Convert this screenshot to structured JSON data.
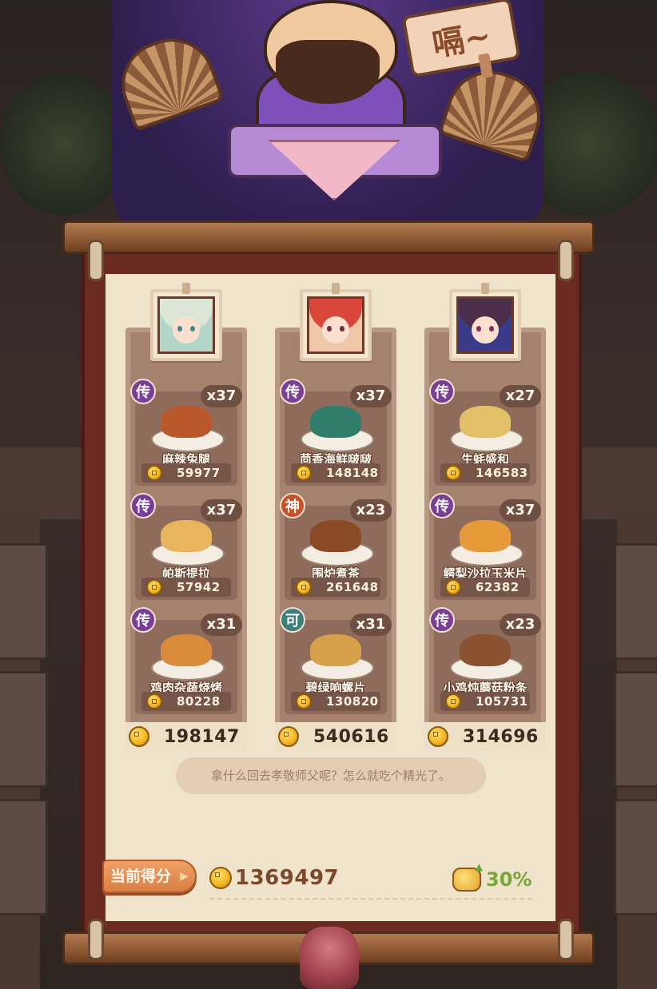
{
  "header": {
    "speech_sign": "嗝~"
  },
  "columns": [
    {
      "portrait": "character-1",
      "dishes": [
        {
          "rarity": "传",
          "rarity_color": "#7a3f94",
          "count": "x37",
          "name": "麻辣兔腿",
          "value": "59977",
          "food_color": "#b9582b"
        },
        {
          "rarity": "传",
          "rarity_color": "#7a3f94",
          "count": "x37",
          "name": "帕斯提拉",
          "value": "57942",
          "food_color": "#e6b55d"
        },
        {
          "rarity": "传",
          "rarity_color": "#7a3f94",
          "count": "x31",
          "name": "鸡肉杂蔬烧烤",
          "value": "80228",
          "food_color": "#d98a3a"
        }
      ],
      "total": "198147"
    },
    {
      "portrait": "character-2",
      "dishes": [
        {
          "rarity": "传",
          "rarity_color": "#7a3f94",
          "count": "x37",
          "name": "茴香海鲜啵啵",
          "value": "148148",
          "food_color": "#2f7d6a"
        },
        {
          "rarity": "神",
          "rarity_color": "#c8522b",
          "count": "x23",
          "name": "围炉煮茶",
          "value": "261648",
          "food_color": "#8a4a26"
        },
        {
          "rarity": "可",
          "rarity_color": "#3c7f7a",
          "count": "x31",
          "name": "碧绿响螺片",
          "value": "130820",
          "food_color": "#d7a04a"
        }
      ],
      "total": "540616"
    },
    {
      "portrait": "character-3",
      "dishes": [
        {
          "rarity": "传",
          "rarity_color": "#7a3f94",
          "count": "x27",
          "name": "生蚝盛和",
          "value": "146583",
          "food_color": "#e1c067"
        },
        {
          "rarity": "传",
          "rarity_color": "#7a3f94",
          "count": "x37",
          "name": "鳄梨沙拉玉米片",
          "value": "62382",
          "food_color": "#e79a3a"
        },
        {
          "rarity": "传",
          "rarity_color": "#7a3f94",
          "count": "x23",
          "name": "小鸡炖蘑菇粉条",
          "value": "105731",
          "food_color": "#8a5230"
        }
      ],
      "total": "314696"
    }
  ],
  "message": "拿什么回去孝敬师父呢？怎么就吃个精光了。",
  "footer": {
    "score_label": "当前得分",
    "total_score": "1369497",
    "bonus_percent": "30%"
  }
}
